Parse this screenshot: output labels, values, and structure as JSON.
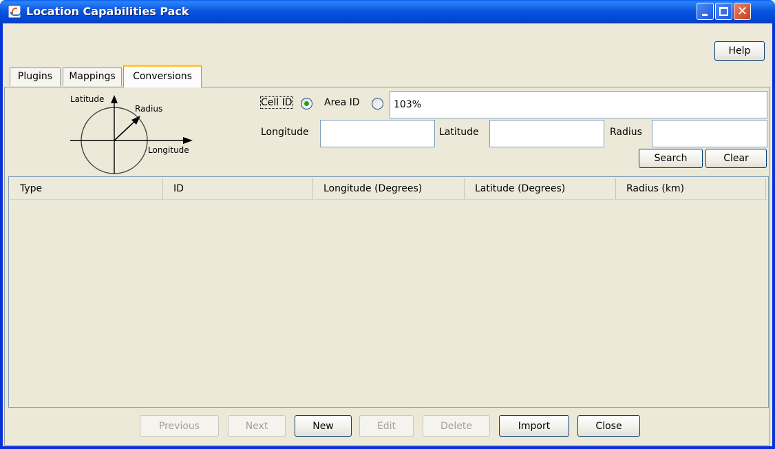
{
  "window": {
    "title": "Location Capabilities Pack"
  },
  "help_button": "Help",
  "tabs": [
    {
      "label": "Plugins",
      "active": false
    },
    {
      "label": "Mappings",
      "active": false
    },
    {
      "label": "Conversions",
      "active": true
    }
  ],
  "diagram": {
    "latitude_label": "Latitude",
    "radius_label": "Radius",
    "longitude_label": "Longitude"
  },
  "search": {
    "cell_id_label": "Cell ID",
    "cell_id_selected": true,
    "area_id_label": "Area ID",
    "area_id_selected": false,
    "id_value": "103%",
    "longitude_label": "Longitude",
    "longitude_value": "",
    "latitude_label": "Latitude",
    "latitude_value": "",
    "radius_label": "Radius",
    "radius_value": "",
    "search_button": "Search",
    "clear_button": "Clear"
  },
  "table": {
    "columns": [
      "Type",
      "ID",
      "Longitude (Degrees)",
      "Latitude (Degrees)",
      "Radius (km)"
    ],
    "rows": []
  },
  "footer": {
    "previous": "Previous",
    "next": "Next",
    "new": "New",
    "edit": "Edit",
    "delete": "Delete",
    "import": "Import",
    "close": "Close"
  },
  "colors": {
    "titlebar": "#0148d6",
    "window_bg": "#ece9d8",
    "active_tab_accent": "#ffc83c",
    "radio_selected": "#21a121"
  },
  "icons": [
    "java-app-icon",
    "minimize-icon",
    "maximize-icon",
    "close-icon"
  ]
}
